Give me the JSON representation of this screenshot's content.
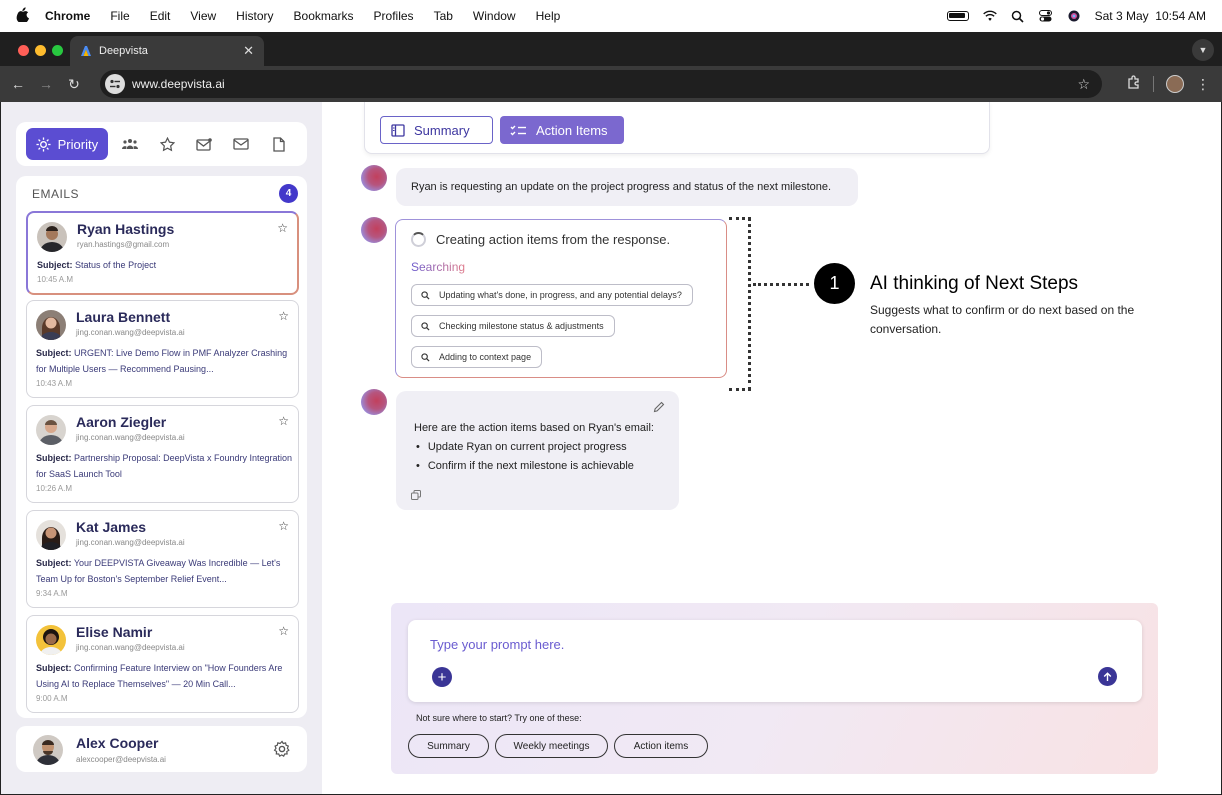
{
  "menubar": {
    "app": "Chrome",
    "items": [
      "File",
      "Edit",
      "View",
      "History",
      "Bookmarks",
      "Profiles",
      "Tab",
      "Window",
      "Help"
    ],
    "datetime": "Sat 3 May  10:54 AM"
  },
  "browser": {
    "tab_title": "Deepvista",
    "url": "www.deepvista.ai"
  },
  "sidebar": {
    "priority_label": "Priority",
    "filter_icons": [
      "people-icon",
      "star-icon",
      "mail-badge-icon",
      "mail-icon",
      "document-icon"
    ],
    "emails_header": "EMAILS",
    "emails_count": "4",
    "emails": [
      {
        "name": "Ryan Hastings",
        "address": "ryan.hastings@gmail.com",
        "subject_label": "Subject:",
        "subject": "Status of the Project",
        "time": "10:45 A.M"
      },
      {
        "name": "Laura Bennett",
        "address": "jing.conan.wang@deepvista.ai",
        "subject_label": "Subject:",
        "subject": "URGENT: Live Demo Flow in PMF Analyzer Crashing for Multiple Users — Recommend Pausing...",
        "time": "10:43 A.M"
      },
      {
        "name": "Aaron Ziegler",
        "address": "jing.conan.wang@deepvista.ai",
        "subject_label": "Subject:",
        "subject": "Partnership Proposal: DeepVista x Foundry Integration for SaaS Launch Tool",
        "time": "10:26 A.M"
      },
      {
        "name": "Kat James",
        "address": "jing.conan.wang@deepvista.ai",
        "subject_label": "Subject:",
        "subject": "Your DEEPVISTA Giveaway Was Incredible — Let's Team Up for Boston's September Relief Event...",
        "time": "9:34 A.M"
      },
      {
        "name": "Elise Namir",
        "address": "jing.conan.wang@deepvista.ai",
        "subject_label": "Subject:",
        "subject": "Confirming Feature Interview on \"How Founders Are Using AI to Replace Themselves\" — 20 Min Call...",
        "time": "9:00 A.M"
      }
    ],
    "user": {
      "name": "Alex Cooper",
      "address": "alexcooper@deepvista.ai"
    }
  },
  "main": {
    "tabs": {
      "summary": "Summary",
      "action_items": "Action Items"
    },
    "message_1": "Ryan is requesting an update on the project progress and status of the next milestone.",
    "thinking": {
      "title": "Creating action items from the response.",
      "searching": "Searching",
      "queries": [
        "Updating what's done, in progress, and any potential delays?",
        "Checking milestone status & adjustments",
        "Adding to context page"
      ]
    },
    "annotation": {
      "number": "1",
      "title": "AI thinking of Next Steps",
      "description": "Suggests what to confirm or do next based on the conversation."
    },
    "message_2": {
      "lead": "Here are the action items based on Ryan's email:",
      "items": [
        "Update Ryan on current project progress",
        "Confirm if the next milestone is achievable"
      ]
    },
    "prompt": {
      "placeholder": "Type your prompt here.",
      "hint": "Not sure where to start? Try one of these:",
      "suggestions": [
        "Summary",
        "Weekly meetings",
        "Action items"
      ]
    }
  },
  "colors": {
    "accent": "#5b4dd2",
    "accent_light": "#7b68cf",
    "dark_accent": "#3a3596",
    "sidebar_bg": "#eeedf3"
  }
}
